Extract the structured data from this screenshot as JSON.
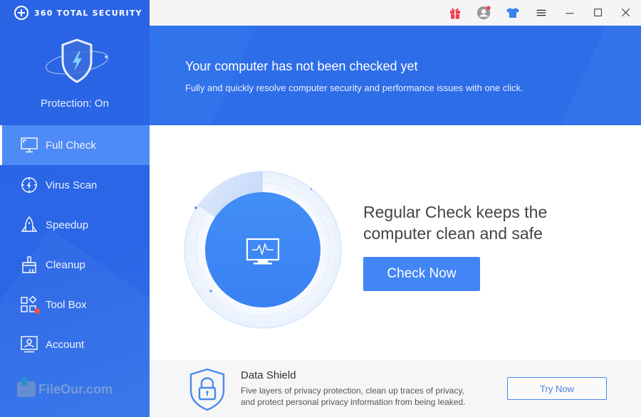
{
  "app": {
    "name": "360 TOTAL SECURITY",
    "protection_status": "Protection: On"
  },
  "titlebar": {
    "icons": [
      "gift-icon",
      "user-avatar-icon",
      "skin-tshirt-icon",
      "menu-icon",
      "minimize-icon",
      "maximize-icon",
      "close-icon"
    ],
    "notification_color": "#f03e4e"
  },
  "sidebar": {
    "items": [
      {
        "label": "Full Check",
        "icon": "monitor-icon",
        "active": true
      },
      {
        "label": "Virus Scan",
        "icon": "virus-scan-icon",
        "active": false
      },
      {
        "label": "Speedup",
        "icon": "rocket-icon",
        "active": false
      },
      {
        "label": "Cleanup",
        "icon": "broom-icon",
        "active": false
      },
      {
        "label": "Tool Box",
        "icon": "toolbox-icon",
        "active": false,
        "badge": true
      },
      {
        "label": "Account",
        "icon": "account-icon",
        "active": false
      }
    ]
  },
  "banner": {
    "title": "Your computer has not been checked yet",
    "subtitle": "Fully and quickly resolve computer security and performance issues with one click."
  },
  "main": {
    "headline_line1": "Regular Check keeps the",
    "headline_line2": "computer clean and safe",
    "check_button": "Check Now"
  },
  "promo": {
    "title": "Data Shield",
    "desc_line1": "Five layers of privacy protection, clean up traces of privacy,",
    "desc_line2": "and protect personal privacy information from being leaked.",
    "button": "Try Now"
  },
  "watermark": "FileOur.com",
  "colors": {
    "sidebar_bg": "#2a64e4",
    "active_item": "#4f8bf6",
    "accent": "#4285f4",
    "banner_bg": "#2e6de8"
  }
}
